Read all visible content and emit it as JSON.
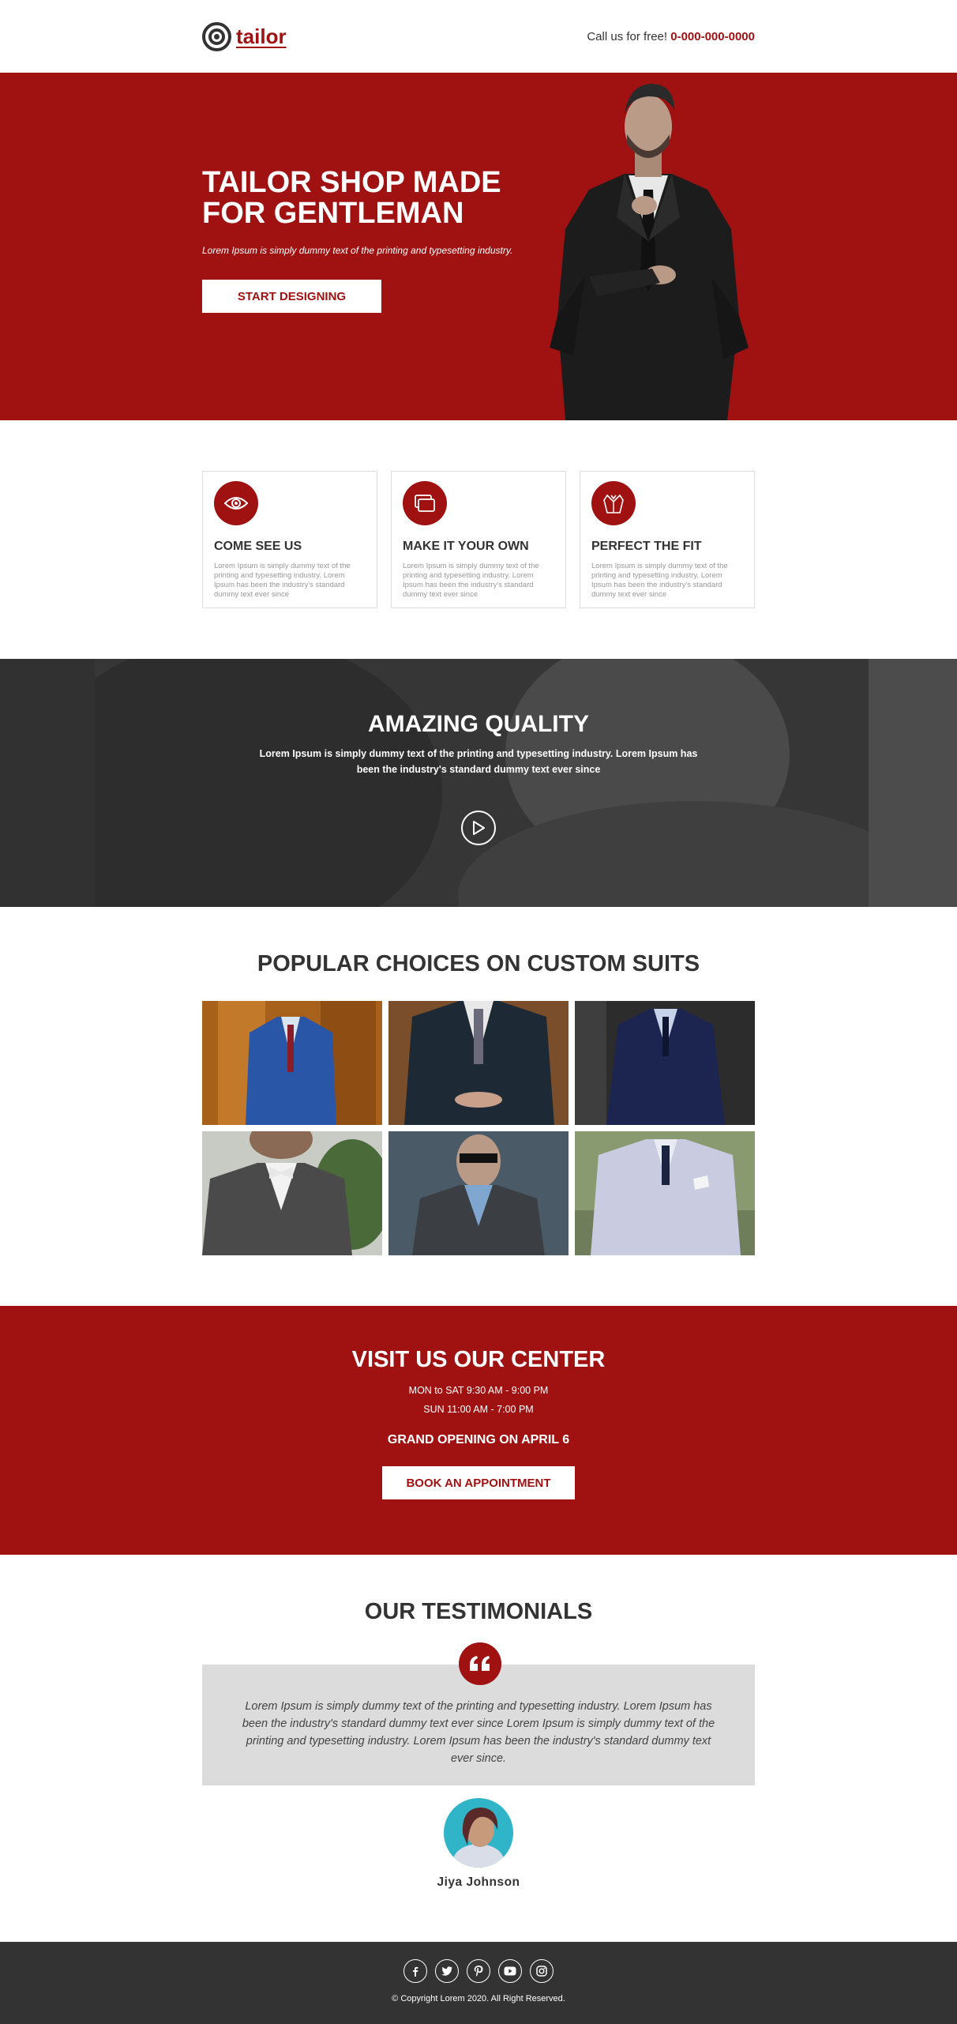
{
  "header": {
    "logo_text": "tailor",
    "call_label": "Call us for free!",
    "phone": "0-000-000-0000"
  },
  "hero": {
    "title": "TAILOR SHOP MADE FOR GENTLEMAN",
    "subtitle": "Lorem Ipsum is simply dummy text of the printing and typesetting industry.",
    "button_label": "START DESIGNING"
  },
  "features": [
    {
      "icon": "eye-icon",
      "title": "COME SEE US",
      "text": "Lorem Ipsum is simply dummy text of the printing and typesetting industry. Lorem Ipsum has been the industry's standard dummy text ever since"
    },
    {
      "icon": "cards-icon",
      "title": "MAKE IT YOUR OWN",
      "text": "Lorem Ipsum is simply dummy text of the printing and typesetting industry. Lorem Ipsum has been the industry's standard dummy text ever since"
    },
    {
      "icon": "suit-icon",
      "title": "PERFECT THE FIT",
      "text": "Lorem Ipsum is simply dummy text of the printing and typesetting industry. Lorem Ipsum has been the industry's standard dummy text ever since"
    }
  ],
  "quality": {
    "title": "AMAZING QUALITY",
    "text": "Lorem Ipsum is simply dummy text of the printing and typesetting industry. Lorem Ipsum has been the industry's standard dummy text ever since"
  },
  "gallery": {
    "title": "POPULAR CHOICES ON CUSTOM SUITS"
  },
  "visit": {
    "title": "VISIT US OUR CENTER",
    "hours_weekday": "MON to SAT 9:30 AM - 9:00 PM",
    "hours_sunday": "SUN 11:00 AM - 7:00 PM",
    "opening": "GRAND OPENING ON APRIL 6",
    "button_label": "BOOK AN APPOINTMENT"
  },
  "testimonials": {
    "title": "OUR TESTIMONIALS",
    "quote": "Lorem Ipsum is simply dummy text of the printing and typesetting industry. Lorem Ipsum has been the industry's standard dummy text ever since Lorem Ipsum is simply dummy text of the printing and typesetting industry. Lorem Ipsum has been the industry's standard dummy text ever since.",
    "name": "Jiya Johnson"
  },
  "footer": {
    "socials": [
      "facebook-icon",
      "twitter-icon",
      "pinterest-icon",
      "youtube-icon",
      "instagram-icon"
    ],
    "copyright": "© Copyright Lorem 2020. All Right Reserved."
  },
  "colors": {
    "brand": "#a01212",
    "dark": "#333333",
    "quote_bg": "#dcdcdc"
  }
}
